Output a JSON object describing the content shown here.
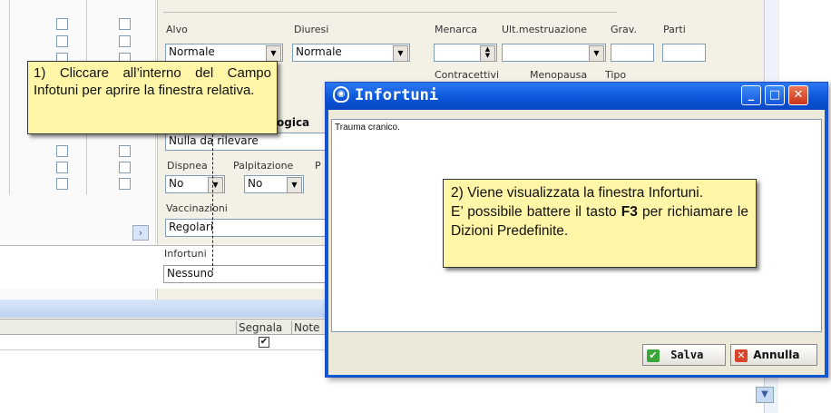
{
  "form": {
    "alvo_label": "Alvo",
    "alvo_value": "Normale",
    "diuresi_label": "Diuresi",
    "diuresi_value": "Normale",
    "menarca_label": "Menarca",
    "ult_mestruazione_label": "Ult.mestruazione",
    "grav_label": "Grav.",
    "parti_label": "Parti",
    "contracettivi_label": "Contracettivi",
    "menopausa_label": "Menopausa",
    "tipo_label": "Tipo",
    "section_heading_partial": "ogica",
    "nulla_value": "Nulla da rilevare",
    "dispnea_label": "Dispnea",
    "dispnea_value": "No",
    "palpitazione_label": "Palpitazione",
    "palpitazione_value": "No",
    "truncated_label": "P",
    "vaccinazioni_label": "Vaccinazioni",
    "vaccinazioni_value": "Regolari",
    "infortuni_label": "Infortuni",
    "infortuni_value": "Nessuno",
    "grid_header_segnala": "Segnala",
    "grid_header_note": "Note"
  },
  "callout1": {
    "text": "1) Cliccare all’interno del Campo Infotuni per aprire la finestra relativa."
  },
  "dialog": {
    "title": "Infortuni",
    "content": "Trauma cranico.",
    "save_label": "Salva",
    "cancel_label": "Annulla"
  },
  "callout2": {
    "line1": "2) Viene visualizzata la finestra Infortuni.",
    "line2_prefix": "E’ possibile battere il tasto ",
    "line2_key": "F3",
    "line2_suffix": " per richiamare le Dizioni Predefinite."
  },
  "colors": {
    "titlebar": "#0a54d8",
    "callout_bg": "#fff6a8",
    "form_bg": "#f3f1e6",
    "close_button": "#d9452b",
    "grid_band": "#c6d8f4"
  }
}
